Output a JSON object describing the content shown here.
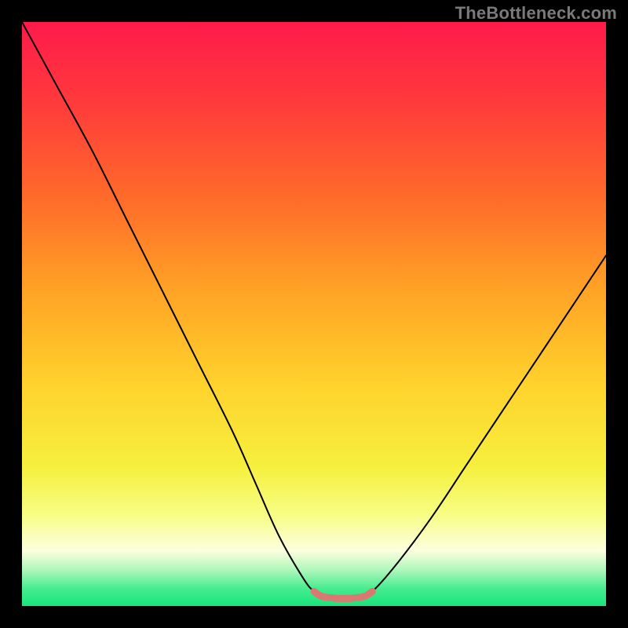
{
  "watermark": "TheBottleneck.com",
  "chart_data": {
    "type": "line",
    "title": "",
    "xlabel": "",
    "ylabel": "",
    "xlim": [
      0,
      100
    ],
    "ylim": [
      0,
      100
    ],
    "grid": false,
    "series": [
      {
        "name": "bottleneck-curve",
        "x": [
          0,
          6,
          12,
          18,
          24,
          30,
          36,
          40,
          44,
          48,
          50,
          52,
          54,
          56,
          58,
          60,
          64,
          70,
          76,
          82,
          88,
          94,
          100
        ],
        "values": [
          100,
          89,
          78,
          66,
          54,
          42,
          30,
          21,
          12,
          5,
          2.5,
          1.5,
          1.3,
          1.3,
          1.5,
          2.5,
          7,
          15,
          24,
          33,
          42,
          51,
          60
        ]
      },
      {
        "name": "optimal-band-marker",
        "x": [
          50,
          51,
          52,
          53,
          54,
          55,
          56,
          57,
          58,
          59,
          60
        ],
        "values": [
          2.5,
          1.8,
          1.5,
          1.4,
          1.3,
          1.3,
          1.3,
          1.4,
          1.5,
          1.8,
          2.5
        ]
      }
    ],
    "background_gradient": {
      "stops": [
        {
          "offset": 0.0,
          "color": "#ff1a4b"
        },
        {
          "offset": 0.14,
          "color": "#ff3b3b"
        },
        {
          "offset": 0.3,
          "color": "#ff6a2a"
        },
        {
          "offset": 0.46,
          "color": "#ffa325"
        },
        {
          "offset": 0.62,
          "color": "#ffd22c"
        },
        {
          "offset": 0.76,
          "color": "#f6ef3d"
        },
        {
          "offset": 0.84,
          "color": "#f7fd80"
        },
        {
          "offset": 0.905,
          "color": "#fdfede"
        },
        {
          "offset": 0.94,
          "color": "#a9f7b8"
        },
        {
          "offset": 0.97,
          "color": "#46ec8f"
        },
        {
          "offset": 1.0,
          "color": "#17e47c"
        }
      ]
    },
    "curve_color": "#000000",
    "marker_color": "#d97a72"
  }
}
